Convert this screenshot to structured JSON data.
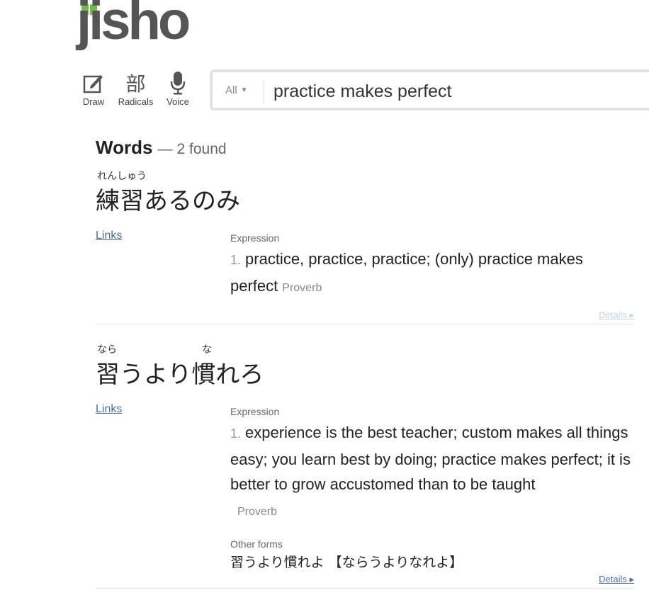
{
  "brand": {
    "logo_text": "jisho",
    "accent": "#6cbd45"
  },
  "tools": {
    "draw": {
      "label": "Draw",
      "icon": "pencil-square-icon"
    },
    "radicals": {
      "label": "Radicals",
      "glyph": "部"
    },
    "voice": {
      "label": "Voice",
      "icon": "microphone-icon"
    }
  },
  "search": {
    "filter": "All",
    "caret": "▼",
    "query": "practice makes perfect"
  },
  "results": {
    "title": "Words",
    "count": "— 2 found",
    "entries": [
      {
        "furigana": [
          {
            "text": "れんしゅう"
          }
        ],
        "word": "練習あるのみ",
        "links": "Links",
        "pos": "Expression",
        "meaning_num": "1.",
        "meaning": "practice, practice, practice; (only) practice makes perfect",
        "tag": "Proverb",
        "details": "Details ▸"
      },
      {
        "furigana": [
          {
            "text": "なら"
          },
          {
            "text": "な"
          }
        ],
        "word": "習うより慣れろ",
        "links": "Links",
        "pos": "Expression",
        "meaning_num": "1.",
        "meaning": "experience is the best teacher; custom makes all things easy; you learn best by doing; practice makes perfect; it is better to grow accustomed than to be taught",
        "tag": "Proverb",
        "other_forms_label": "Other forms",
        "other_forms": "習うより慣れよ 【ならうよりなれよ】",
        "details": "Details ▸"
      }
    ]
  },
  "colors": {
    "link": "#4a6ea0",
    "details_faded": "#c5d3e6",
    "details": "#4a6ea0"
  }
}
